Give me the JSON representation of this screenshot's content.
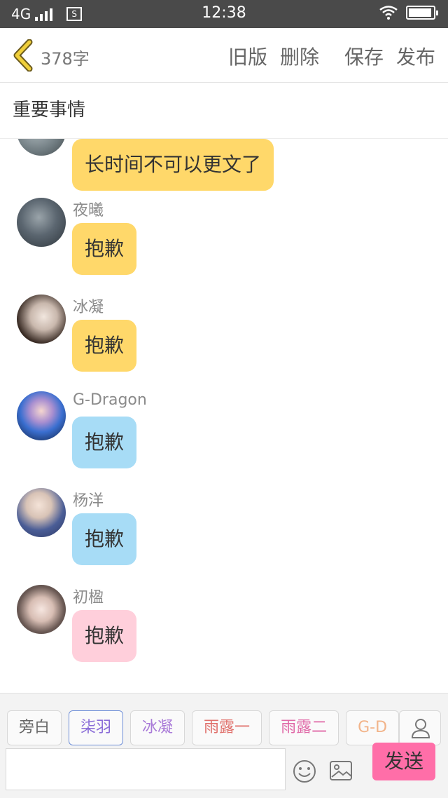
{
  "status_bar": {
    "network": "4G",
    "sim_label": "S",
    "time": "12:38"
  },
  "toolbar": {
    "word_count": "378字",
    "old_version": "旧版",
    "delete": "删除",
    "save": "保存",
    "publish": "发布"
  },
  "document": {
    "title": "重要事情"
  },
  "messages": [
    {
      "name": "",
      "text": "长时间不可以更文了",
      "bubble_color": "#ffd86a"
    },
    {
      "name": "夜曦",
      "text": "抱歉",
      "bubble_color": "#ffd86a"
    },
    {
      "name": "冰凝",
      "text": "抱歉",
      "bubble_color": "#ffd86a"
    },
    {
      "name": "G-Dragon",
      "text": "抱歉",
      "bubble_color": "#a7dcf6"
    },
    {
      "name": "杨洋",
      "text": "抱歉",
      "bubble_color": "#a7dcf6"
    },
    {
      "name": "初楹",
      "text": "抱歉",
      "bubble_color": "#ffcfdb"
    }
  ],
  "roles": [
    {
      "label": "旁白",
      "color": "#666666"
    },
    {
      "label": "柒羽",
      "color": "#8a6cd8",
      "selected": true
    },
    {
      "label": "冰凝",
      "color": "#a97ad8"
    },
    {
      "label": "雨露一",
      "color": "#e0706b"
    },
    {
      "label": "雨露二",
      "color": "#e06aa8"
    },
    {
      "label": "G-D",
      "color": "#f2b48a"
    }
  ],
  "composer": {
    "input_value": "",
    "send_label": "发送"
  },
  "colors": {
    "accent": "#ff6ea8",
    "back_chevron": "#e8c430",
    "status_bar_bg": "#4a4a4a"
  }
}
